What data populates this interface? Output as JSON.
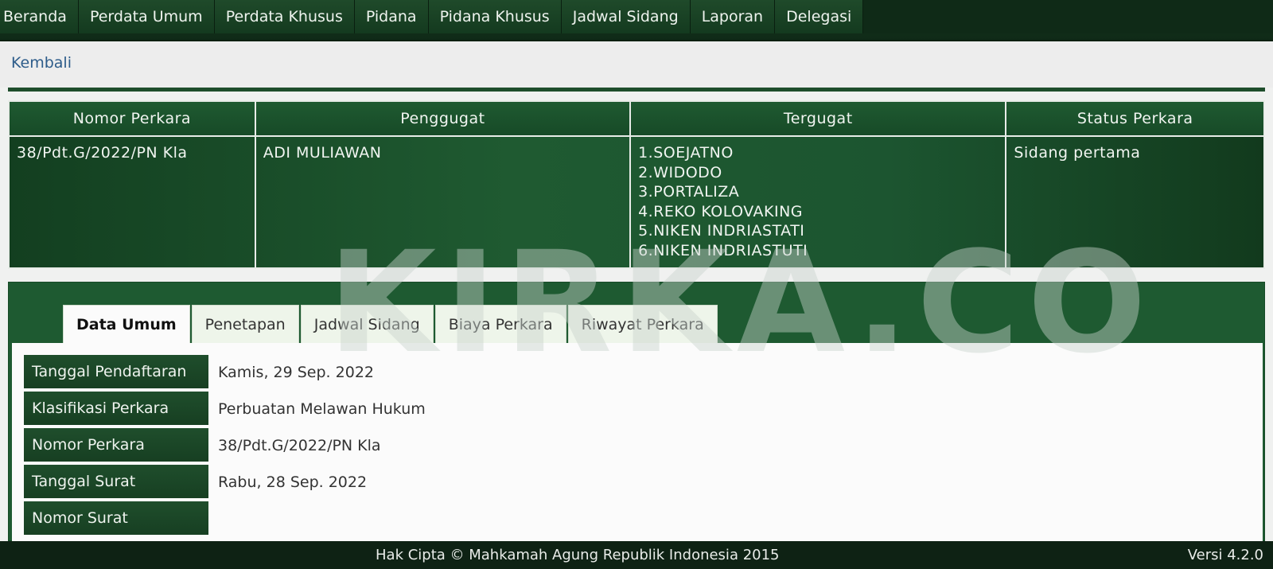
{
  "nav": {
    "items": [
      "Beranda",
      "Perdata Umum",
      "Perdata Khusus",
      "Pidana",
      "Pidana Khusus",
      "Jadwal Sidang",
      "Laporan",
      "Delegasi"
    ]
  },
  "back_label": "Kembali",
  "case_table": {
    "headers": [
      "Nomor Perkara",
      "Penggugat",
      "Tergugat",
      "Status Perkara"
    ],
    "row": {
      "nomor_perkara": "38/Pdt.G/2022/PN Kla",
      "penggugat": "ADI MULIAWAN",
      "tergugat": [
        "1.SOEJATNO",
        "2.WIDODO",
        "3.PORTALIZA",
        "4.REKO KOLOVAKING",
        "5.NIKEN INDRIASTATI",
        "6.NIKEN INDRIASTUTI"
      ],
      "status": "Sidang pertama"
    }
  },
  "tabs": [
    "Data Umum",
    "Penetapan",
    "Jadwal Sidang",
    "Biaya Perkara",
    "Riwayat Perkara"
  ],
  "active_tab": "Data Umum",
  "info": [
    {
      "label": "Tanggal Pendaftaran",
      "value": "Kamis, 29 Sep. 2022"
    },
    {
      "label": "Klasifikasi Perkara",
      "value": "Perbuatan Melawan Hukum"
    },
    {
      "label": "Nomor Perkara",
      "value": "38/Pdt.G/2022/PN Kla"
    },
    {
      "label": "Tanggal Surat",
      "value": "Rabu, 28 Sep. 2022"
    },
    {
      "label": "Nomor Surat",
      "value": ""
    }
  ],
  "footer": {
    "copyright": "Hak Cipta © Mahkamah Agung Republik Indonesia 2015",
    "version": "Versi 4.2.0"
  },
  "watermark": "KIRKA.CO",
  "colors": {
    "primary_green": "#1e5a31",
    "dark_green": "#0f2a17",
    "link_blue": "#2d5c8a"
  }
}
